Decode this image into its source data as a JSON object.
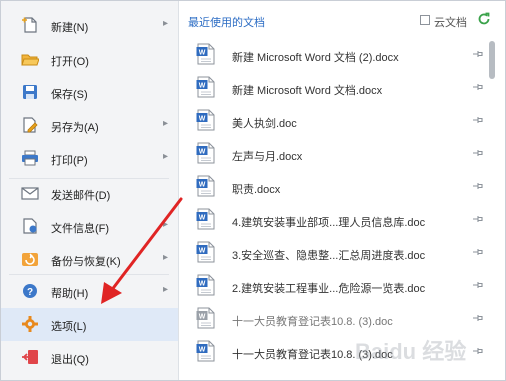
{
  "menu": {
    "items": [
      {
        "label": "新建(N)",
        "icon": "new-file-icon",
        "has_submenu": true
      },
      {
        "label": "打开(O)",
        "icon": "folder-open-icon",
        "has_submenu": false
      },
      {
        "label": "保存(S)",
        "icon": "save-icon",
        "has_submenu": false
      },
      {
        "label": "另存为(A)",
        "icon": "save-as-icon",
        "has_submenu": true
      },
      {
        "label": "打印(P)",
        "icon": "print-icon",
        "has_submenu": true
      },
      {
        "label": "发送邮件(D)",
        "icon": "mail-icon",
        "has_submenu": false
      },
      {
        "label": "文件信息(F)",
        "icon": "file-info-icon",
        "has_submenu": true
      },
      {
        "label": "备份与恢复(K)",
        "icon": "backup-icon",
        "has_submenu": true
      },
      {
        "label": "帮助(H)",
        "icon": "help-icon",
        "has_submenu": true
      },
      {
        "label": "选项(L)",
        "icon": "gear-icon",
        "has_submenu": false,
        "selected": true
      },
      {
        "label": "退出(Q)",
        "icon": "exit-icon",
        "has_submenu": false
      }
    ],
    "submenu_arrow": "▸"
  },
  "recent": {
    "title": "最近使用的文档",
    "cloud_label": "云文档",
    "files": [
      {
        "name": "新建 Microsoft Word 文档 (2).docx"
      },
      {
        "name": "新建 Microsoft Word 文档.docx"
      },
      {
        "name": "美人执剑.doc"
      },
      {
        "name": "左声与月.docx"
      },
      {
        "name": "职责.docx"
      },
      {
        "name": "4.建筑安装事业部项...理人员信息库.doc"
      },
      {
        "name": "3.安全巡查、隐患整...汇总周进度表.doc"
      },
      {
        "name": "2.建筑安装工程事业...危险源一览表.doc"
      },
      {
        "name": "十一大员教育登记表10.8. (3).doc",
        "dimmed": true
      },
      {
        "name": "十一大员教育登记表10.8. (3).doc"
      }
    ]
  },
  "watermark": "Baidu 经验",
  "colors": {
    "accent": "#2b6cc4",
    "selected_bg": "#dfe9f7",
    "arrow_red": "#e02424",
    "word_blue": "#2f6bbf"
  }
}
